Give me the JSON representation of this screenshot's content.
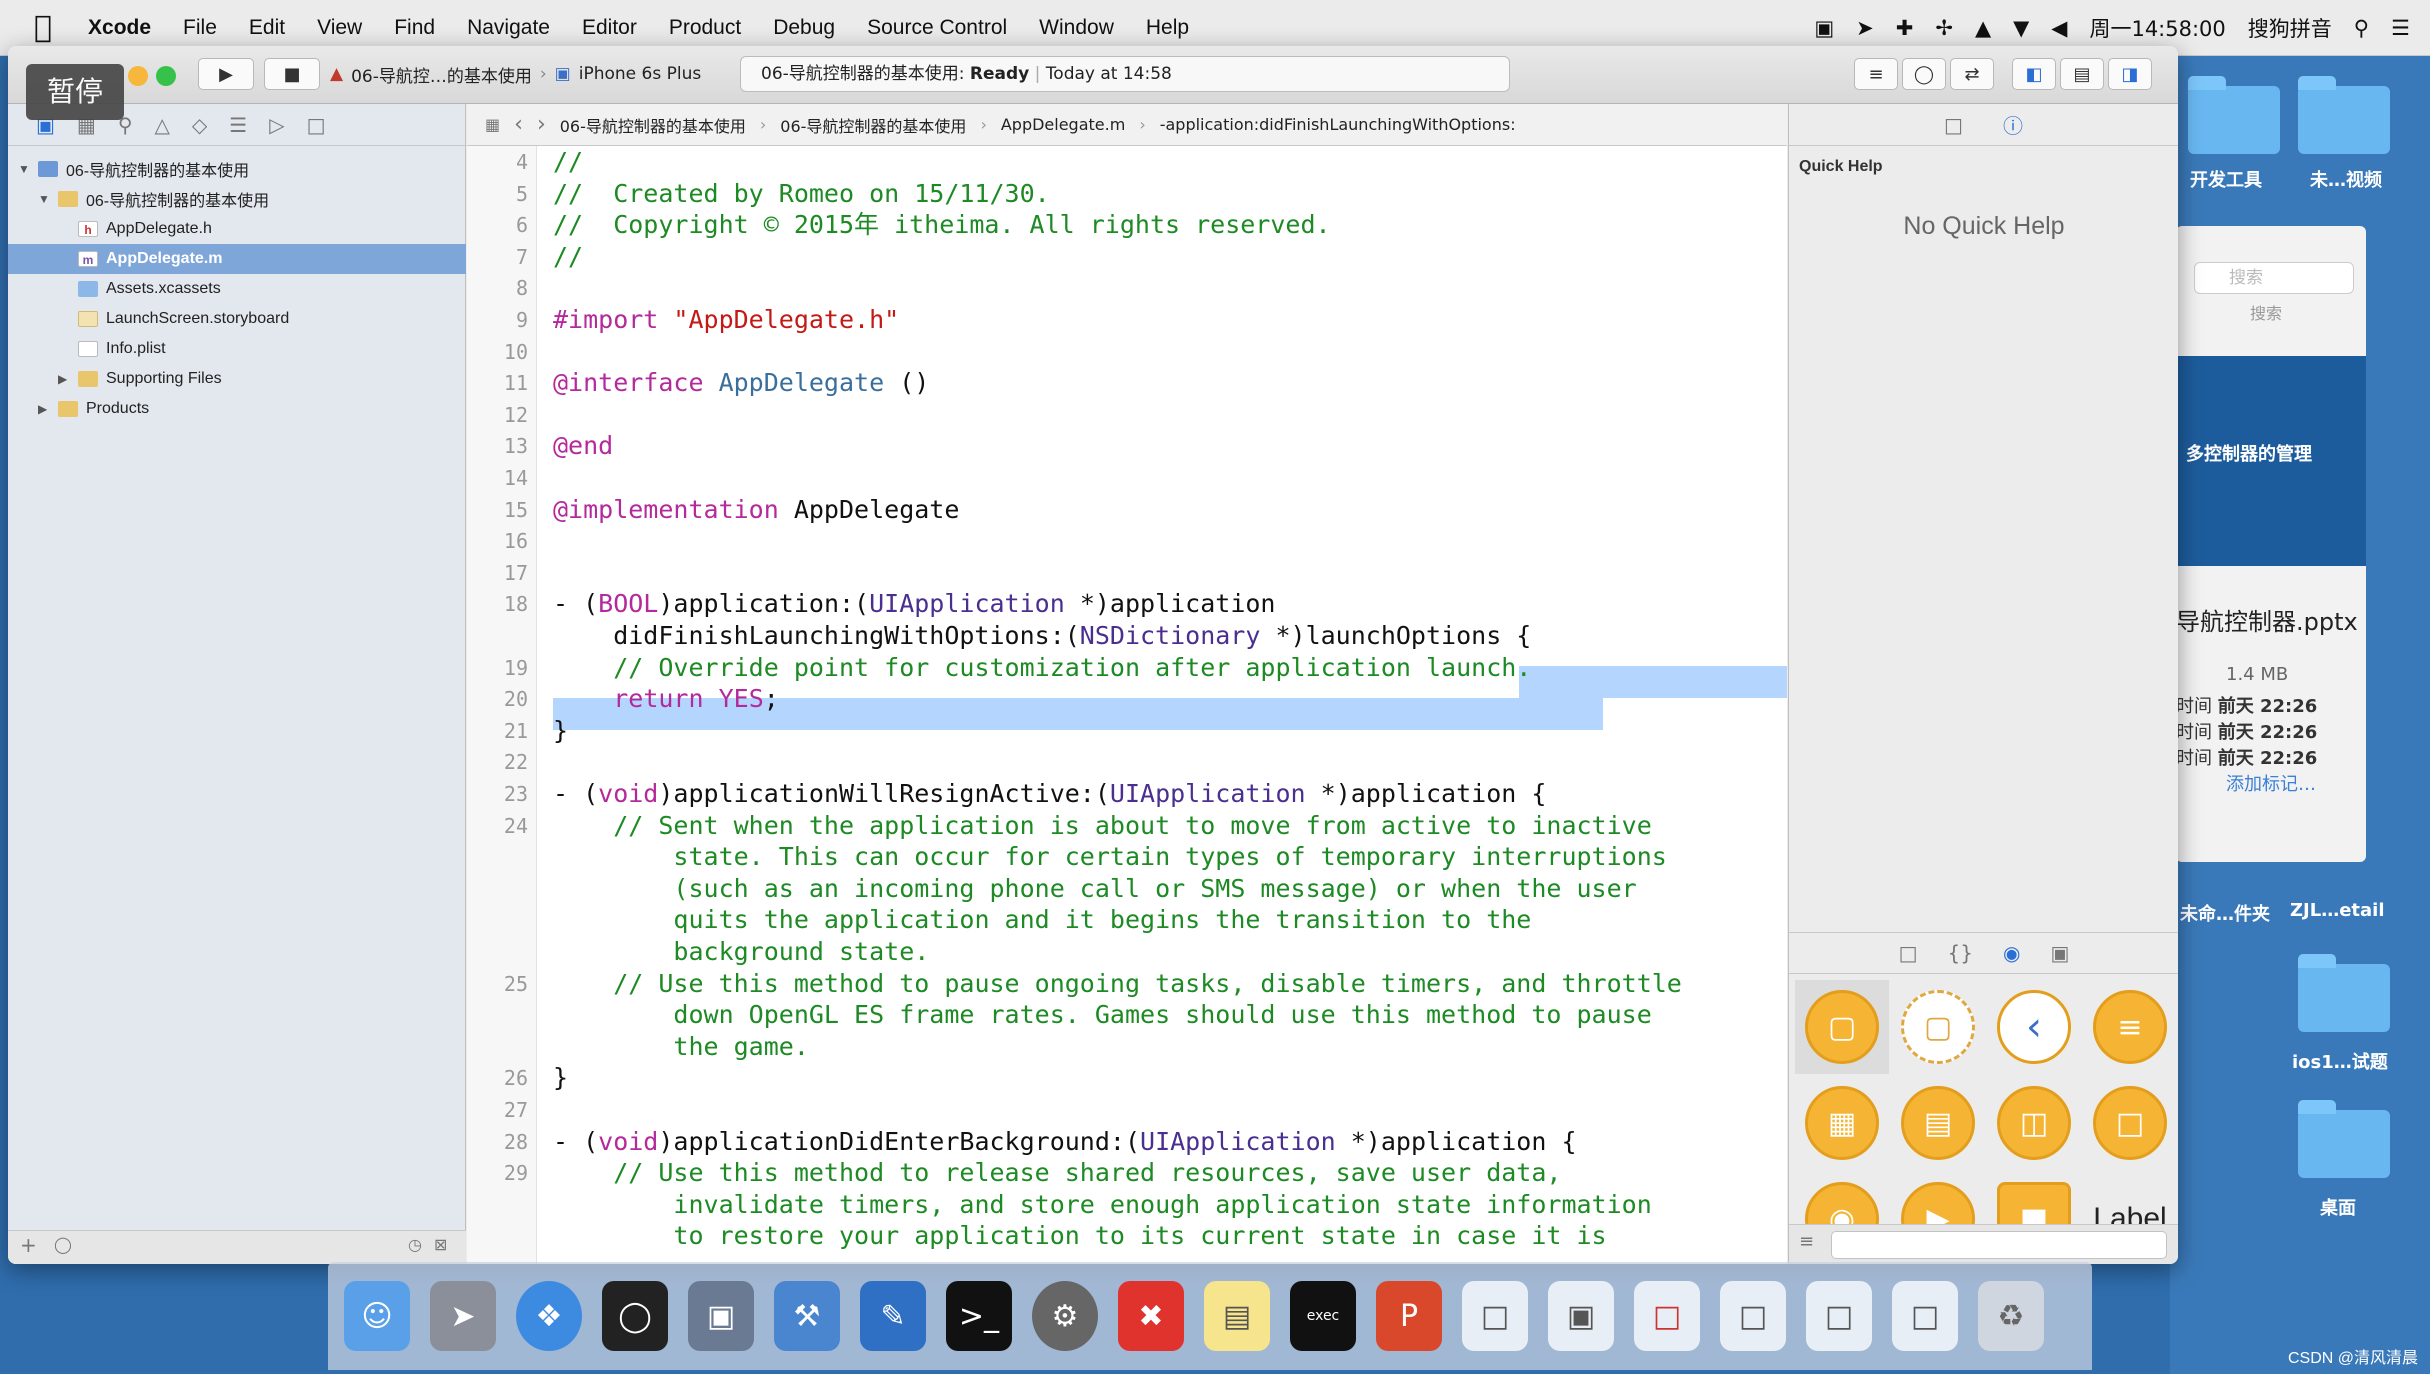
{
  "menubar": {
    "app": "Xcode",
    "items": [
      "File",
      "Edit",
      "View",
      "Find",
      "Navigate",
      "Editor",
      "Product",
      "Debug",
      "Source Control",
      "Window",
      "Help"
    ],
    "clock": "周一14:58:00",
    "input_method": "搜狗拼音"
  },
  "toolbar": {
    "pause_badge": "暂停",
    "scheme": "06-导航控…的基本使用",
    "device": "iPhone 6s Plus",
    "activity_project": "06-导航控制器的基本使用:",
    "activity_status": "Ready",
    "activity_time": "Today at 14:58"
  },
  "navigator": {
    "tree": [
      {
        "label": "06-导航控制器的基本使用",
        "level": 0,
        "icon": "proj",
        "open": true
      },
      {
        "label": "06-导航控制器的基本使用",
        "level": 1,
        "icon": "folder",
        "open": true
      },
      {
        "label": "AppDelegate.h",
        "level": 2,
        "icon": "h",
        "badge": "h"
      },
      {
        "label": "AppDelegate.m",
        "level": 2,
        "icon": "m",
        "badge": "m",
        "selected": true
      },
      {
        "label": "Assets.xcassets",
        "level": 2,
        "icon": "asset"
      },
      {
        "label": "LaunchScreen.storyboard",
        "level": 2,
        "icon": "sb"
      },
      {
        "label": "Info.plist",
        "level": 2,
        "icon": "plist"
      },
      {
        "label": "Supporting Files",
        "level": 2,
        "icon": "folder",
        "closed": true
      },
      {
        "label": "Products",
        "level": 1,
        "icon": "folder",
        "closed": true
      }
    ]
  },
  "jumpbar": {
    "crumbs": [
      "06-导航控制器的基本使用",
      "06-导航控制器的基本使用",
      "AppDelegate.m",
      "-application:didFinishLaunchingWithOptions:"
    ]
  },
  "editor": {
    "line_numbers": [
      "4",
      "5",
      "6",
      "7",
      "8",
      "9",
      "10",
      "11",
      "12",
      "13",
      "14",
      "15",
      "16",
      "17",
      "18",
      "19",
      "20",
      "21",
      "22",
      "23",
      "24",
      "25",
      "26",
      "27",
      "28",
      "29"
    ],
    "lines": [
      {
        "n": "4",
        "html": "<span class='c-comment'>//</span>"
      },
      {
        "n": "5",
        "html": "<span class='c-comment'>//  Created by Romeo on 15/11/30.</span>"
      },
      {
        "n": "6",
        "html": "<span class='c-comment'>//  Copyright © 2015年 itheima. All rights reserved.</span>"
      },
      {
        "n": "7",
        "html": "<span class='c-comment'>//</span>"
      },
      {
        "n": "8",
        "html": ""
      },
      {
        "n": "9",
        "html": "<span class='c-kw'>#import</span> <span class='c-str'>\"AppDelegate.h\"</span>"
      },
      {
        "n": "10",
        "html": ""
      },
      {
        "n": "11",
        "html": "<span class='c-kw'>@interface</span> <span class='c-cls'>AppDelegate</span> ()"
      },
      {
        "n": "12",
        "html": ""
      },
      {
        "n": "13",
        "html": "<span class='c-kw'>@end</span>"
      },
      {
        "n": "14",
        "html": ""
      },
      {
        "n": "15",
        "html": "<span class='c-kw'>@implementation</span> AppDelegate"
      },
      {
        "n": "16",
        "html": ""
      },
      {
        "n": "17",
        "html": ""
      },
      {
        "n": "18",
        "html": "- (<span class='c-kw'>BOOL</span>)application:(<span class='c-type'>UIApplication</span> *)application"
      },
      {
        "n": "",
        "html": "    didFinishLaunchingWithOptions:(<span class='c-type'>NSDictionary</span> *)launchOptions {"
      },
      {
        "n": "19",
        "html": "    <span class='c-comment'>// Override point for customization after application launch.</span>"
      },
      {
        "n": "20",
        "html": "    <span class='c-kw'>return</span> <span class='c-kw'>YES</span>;"
      },
      {
        "n": "21",
        "html": "}"
      },
      {
        "n": "22",
        "html": ""
      },
      {
        "n": "23",
        "html": "- (<span class='c-kw'>void</span>)applicationWillResignActive:(<span class='c-type'>UIApplication</span> *)application {"
      },
      {
        "n": "24",
        "html": "    <span class='c-comment'>// Sent when the application is about to move from active to inactive</span>"
      },
      {
        "n": "",
        "html": "        <span class='c-comment'>state. This can occur for certain types of temporary interruptions</span>"
      },
      {
        "n": "",
        "html": "        <span class='c-comment'>(such as an incoming phone call or SMS message) or when the user</span>"
      },
      {
        "n": "",
        "html": "        <span class='c-comment'>quits the application and it begins the transition to the</span>"
      },
      {
        "n": "",
        "html": "        <span class='c-comment'>background state.</span>"
      },
      {
        "n": "25",
        "html": "    <span class='c-comment'>// Use this method to pause ongoing tasks, disable timers, and throttle</span>"
      },
      {
        "n": "",
        "html": "        <span class='c-comment'>down OpenGL ES frame rates. Games should use this method to pause</span>"
      },
      {
        "n": "",
        "html": "        <span class='c-comment'>the game.</span>"
      },
      {
        "n": "26",
        "html": "}"
      },
      {
        "n": "27",
        "html": ""
      },
      {
        "n": "28",
        "html": "- (<span class='c-kw'>void</span>)applicationDidEnterBackground:(<span class='c-type'>UIApplication</span> *)application {"
      },
      {
        "n": "29",
        "html": "    <span class='c-comment'>// Use this method to release shared resources, save user data,</span>"
      },
      {
        "n": "",
        "html": "        <span class='c-comment'>invalidate timers, and store enough application state information</span>"
      },
      {
        "n": "",
        "html": "        <span class='c-comment'>to restore your application to its current state in case it is</span>"
      }
    ]
  },
  "utilities": {
    "quick_help_title": "Quick Help",
    "quick_help_empty": "No Quick Help",
    "library_last_label": "Label"
  },
  "desktop": {
    "label_devtools": "开发工具",
    "label_unnamed_video": "未…视频",
    "label_unnamed_folder": "未命…件夹",
    "label_zjl": "ZJL…etail",
    "label_ios1": "ios1…试题",
    "label_desktop": "桌面",
    "search_placeholder": "搜索",
    "search_caption": "搜索",
    "thumb_title": "多控制器的管理",
    "file_name": "导航控制器.pptx",
    "file_size": "1.4 MB",
    "row_prefix": "时间",
    "date1": "前天 22:26",
    "date2": "前天 22:26",
    "date3": "前天 22:26",
    "add_tag": "添加标记…"
  },
  "watermark": "CSDN @清风清晨"
}
